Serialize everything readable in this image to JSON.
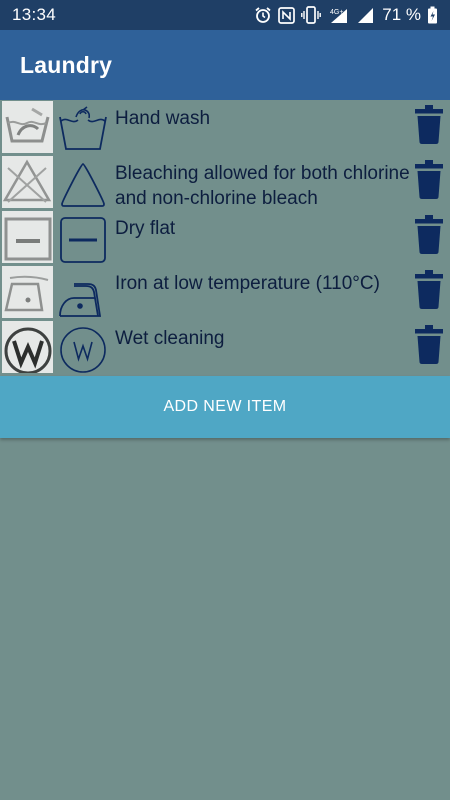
{
  "status_bar": {
    "time": "13:34",
    "network": "4G+",
    "battery": "71 %",
    "icons": [
      "alarm-icon",
      "nfc-icon",
      "vibrate-icon",
      "signal-icon",
      "signal-icon",
      "battery-icon"
    ]
  },
  "app_bar": {
    "title": "Laundry"
  },
  "items": [
    {
      "label": "Hand wash",
      "symbol": "hand-wash-icon"
    },
    {
      "label": "Bleaching allowed for both chlorine and non-chlorine bleach",
      "symbol": "bleach-allowed-icon"
    },
    {
      "label": "Dry flat",
      "symbol": "dry-flat-icon"
    },
    {
      "label": "Iron at low temperature (110°C)",
      "symbol": "iron-low-icon"
    },
    {
      "label": "Wet cleaning",
      "symbol": "wet-cleaning-icon"
    }
  ],
  "add_button": {
    "label": "ADD NEW ITEM"
  },
  "colors": {
    "status_bar": "#1f3f66",
    "app_bar": "#2f6199",
    "background": "#728f8c",
    "button": "#4fa7c5",
    "text": "#0d1e3f",
    "icon": "#0d2a5f"
  }
}
